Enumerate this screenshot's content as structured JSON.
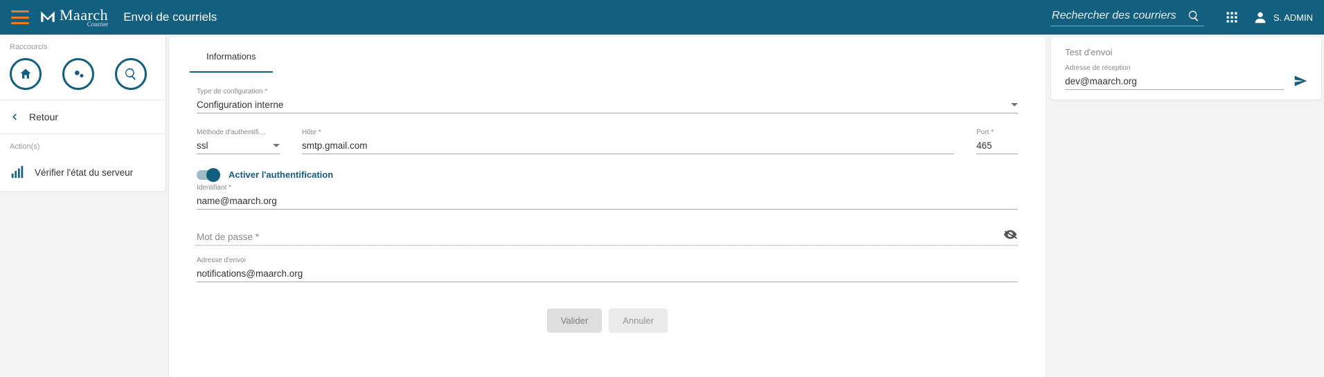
{
  "header": {
    "logo_brand": "Maarch",
    "logo_sub": "Courrier",
    "page_title": "Envoi de courriels",
    "search_placeholder": "Rechercher des courriers",
    "user_name": "S. ADMIN"
  },
  "sidebar": {
    "shortcuts_label": "Raccourcis",
    "back_label": "Retour",
    "actions_label": "Action(s)",
    "action_items": [
      {
        "label": "Vérifier l'état du serveur"
      }
    ]
  },
  "form": {
    "tab_label": "Informations",
    "config_type_label": "Type de configuration *",
    "config_type_value": "Configuration interne",
    "auth_method_label": "Méthode d'authentific…",
    "auth_method_value": "ssl",
    "host_label": "Hôte *",
    "host_value": "smtp.gmail.com",
    "port_label": "Port *",
    "port_value": "465",
    "auth_toggle_label": "Activer l'authentification",
    "identifier_label": "Identifiant *",
    "identifier_value": "name@maarch.org",
    "password_label": "Mot de passe *",
    "send_address_label": "Adresse d'envoi",
    "send_address_value": "notifications@maarch.org",
    "validate_btn": "Valider",
    "cancel_btn": "Annuler"
  },
  "test": {
    "title": "Test d'envoi",
    "recv_label": "Adresse de réception",
    "recv_value": "dev@maarch.org"
  }
}
